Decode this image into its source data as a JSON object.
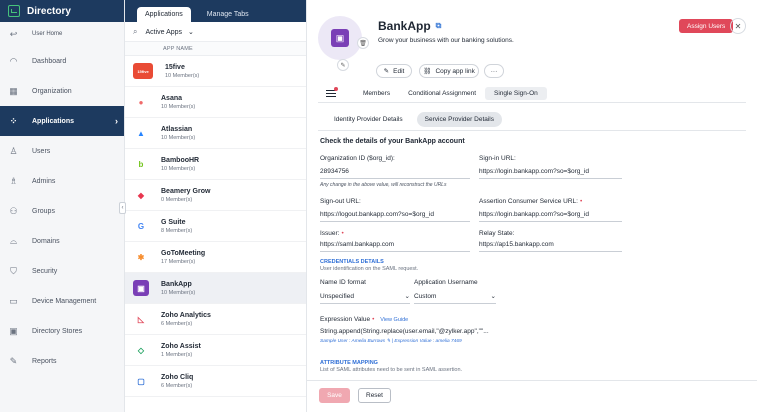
{
  "sidebar": {
    "title": "Directory",
    "user_home": "User Home",
    "items": [
      {
        "label": "Dashboard",
        "icon": "dashboard-icon"
      },
      {
        "label": "Organization",
        "icon": "building-icon"
      },
      {
        "label": "Applications",
        "icon": "apps-icon",
        "active": true
      },
      {
        "label": "Users",
        "icon": "user-icon"
      },
      {
        "label": "Admins",
        "icon": "admin-icon"
      },
      {
        "label": "Groups",
        "icon": "groups-icon"
      },
      {
        "label": "Domains",
        "icon": "globe-icon"
      },
      {
        "label": "Security",
        "icon": "shield-icon"
      },
      {
        "label": "Device Management",
        "icon": "device-icon"
      },
      {
        "label": "Directory Stores",
        "icon": "store-icon"
      },
      {
        "label": "Reports",
        "icon": "reports-icon"
      }
    ]
  },
  "middle": {
    "tabs": [
      "Applications",
      "Manage Tabs"
    ],
    "filter": "Active Apps",
    "column_header": "APP NAME",
    "apps": [
      {
        "name": "15five",
        "members": "10 Member(s)",
        "logo_text": "15five",
        "logo_bg": "#e94b35",
        "logo_color": "#ffffff"
      },
      {
        "name": "Asana",
        "members": "10 Member(s)",
        "logo_text": "●",
        "logo_bg": "#ffffff",
        "logo_color": "#f06a6a"
      },
      {
        "name": "Atlassian",
        "members": "10 Member(s)",
        "logo_text": "▲",
        "logo_bg": "#ffffff",
        "logo_color": "#2684ff"
      },
      {
        "name": "BambooHR",
        "members": "10 Member(s)",
        "logo_text": "b",
        "logo_bg": "#ffffff",
        "logo_color": "#73c41d"
      },
      {
        "name": "Beamery Grow",
        "members": "0 Member(s)",
        "logo_text": "◆",
        "logo_bg": "#ffffff",
        "logo_color": "#e8364f"
      },
      {
        "name": "G Suite",
        "members": "8 Member(s)",
        "logo_text": "G",
        "logo_bg": "#ffffff",
        "logo_color": "#4285f4"
      },
      {
        "name": "GoToMeeting",
        "members": "17 Member(s)",
        "logo_text": "✱",
        "logo_bg": "#ffffff",
        "logo_color": "#f68d2e"
      },
      {
        "name": "BankApp",
        "members": "10 Member(s)",
        "logo_text": "▣",
        "logo_bg": "#7a3fb6",
        "logo_color": "#ffffff",
        "selected": true
      },
      {
        "name": "Zoho Analytics",
        "members": "6 Member(s)",
        "logo_text": "◺",
        "logo_bg": "#ffffff",
        "logo_color": "#e0485a"
      },
      {
        "name": "Zoho Assist",
        "members": "1 Member(s)",
        "logo_text": "◇",
        "logo_bg": "#ffffff",
        "logo_color": "#1a9f5c"
      },
      {
        "name": "Zoho Cliq",
        "members": "6 Member(s)",
        "logo_text": "▢",
        "logo_bg": "#ffffff",
        "logo_color": "#2f6fd6"
      }
    ]
  },
  "detail": {
    "app_name": "BankApp",
    "tagline": "Grow your business with our banking solutions.",
    "assign_button": "Assign Users",
    "edit_button": "Edit",
    "copy_link_button": "Copy app link",
    "more_button": "···",
    "tabs": [
      "Members",
      "Conditional Assignment",
      "Single Sign-On"
    ],
    "subtabs": [
      "Identity Provider Details",
      "Service Provider Details"
    ],
    "section_title": "Check the details of your BankApp account",
    "fields": {
      "org_id_label": "Organization ID ($org_id):",
      "org_id_value": "28934756",
      "org_id_note": "Any change in the above value, will reconstruct the URLs",
      "signin_label": "Sign-in URL:",
      "signin_value": "https://login.bankapp.com?so=$org_id",
      "signout_label": "Sign-out URL:",
      "signout_value": "https://logout.bankapp.com?so=$org_id",
      "acs_label": "Assertion Consumer Service URL:",
      "acs_value": "https://login.bankapp.com?so=$org_id",
      "issuer_label": "Issuer:",
      "issuer_value": "https://saml.bankapp.com",
      "relay_label": "Relay State:",
      "relay_value": "https://ap15.bankapp.com"
    },
    "credentials": {
      "heading": "CREDENTIALS DETAILS",
      "sub": "User identification on the SAML request.",
      "nameid_label": "Name ID format",
      "nameid_value": "Unspecified",
      "appuser_label": "Application Username",
      "appuser_value": "Custom",
      "expr_label": "Expression Value",
      "expr_link": "View Guide",
      "expr_value": "String.append(String.replace(user.email,\"@zylker.app\",\"\"...",
      "sample": "Sample User : Amelia Burrows ✎ | Expression Value : amelia 7469"
    },
    "attribute": {
      "heading": "ATTRIBUTE MAPPING",
      "sub": "List of SAML attributes need to be sent in SAML assertion."
    },
    "save_button": "Save",
    "reset_button": "Reset"
  },
  "colors": {
    "navy": "#1d3a5f",
    "accent_red": "#e0485a",
    "link_blue": "#2f6fd6",
    "app_purple": "#7a3fb6"
  }
}
